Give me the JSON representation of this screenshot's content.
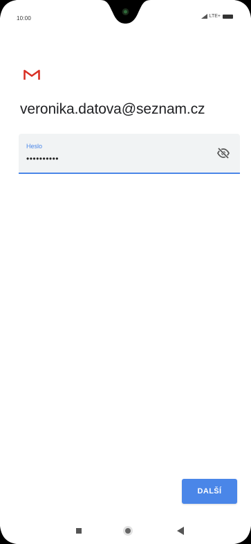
{
  "status_bar": {
    "time": "10:00",
    "network": "LTE+"
  },
  "app": {
    "logo_icon": "gmail-m-icon",
    "accent_color": "#4a86e8",
    "logo_red": "#d93025"
  },
  "account": {
    "email": "veronika.datova@seznam.cz"
  },
  "password_field": {
    "label": "Heslo",
    "value": "••••••••••",
    "toggle_icon": "visibility-off-icon"
  },
  "actions": {
    "next_label": "DALŠÍ"
  },
  "navigation": {
    "recents_icon": "square-icon",
    "home_icon": "circle-icon",
    "back_icon": "triangle-back-icon"
  }
}
